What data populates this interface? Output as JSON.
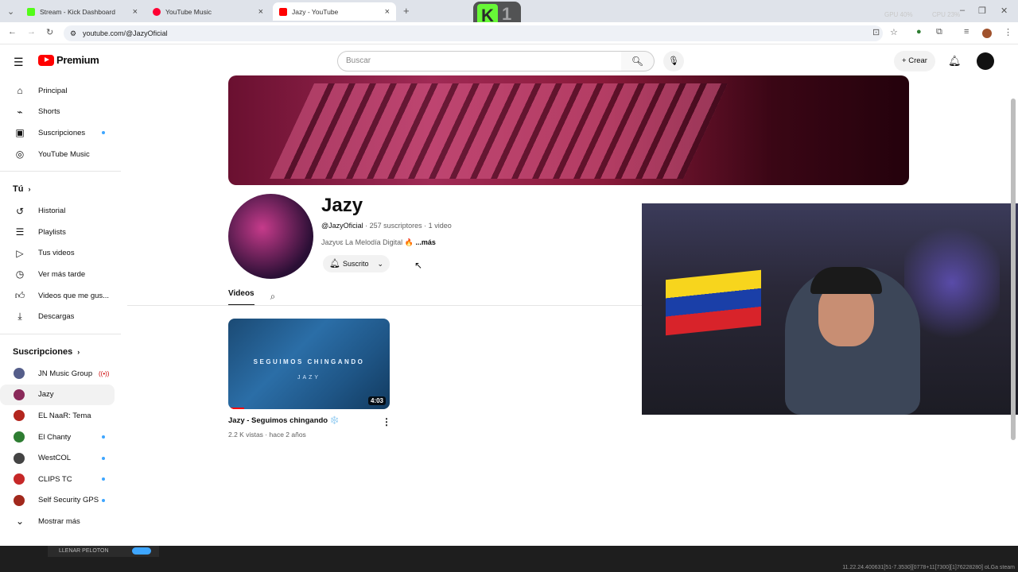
{
  "browser": {
    "tabs": [
      {
        "title": "Stream - Kick Dashboard",
        "icon": "kick-icon",
        "color": "#53fc18"
      },
      {
        "title": "YouTube Music",
        "icon": "youtube-music-icon",
        "color": "#ff0033"
      },
      {
        "title": "Jazy - YouTube",
        "icon": "youtube-icon",
        "color": "#ff0000"
      }
    ],
    "url": "youtube.com/@JazyOficial",
    "sys": {
      "gpu": "GPU 40%",
      "cpu": "CPU 23%"
    },
    "overlay_badge": {
      "letter": "K",
      "number": "1"
    }
  },
  "masthead": {
    "logo": "Premium",
    "search_placeholder": "Buscar",
    "create_label": "Crear"
  },
  "sidebar": {
    "main": [
      {
        "label": "Principal",
        "icon": "home-icon"
      },
      {
        "label": "Shorts",
        "icon": "shorts-icon"
      },
      {
        "label": "Suscripciones",
        "icon": "subscriptions-icon",
        "dot": true
      },
      {
        "label": "YouTube Music",
        "icon": "youtube-music-icon"
      }
    ],
    "you_heading": "Tú",
    "you": [
      {
        "label": "Historial",
        "icon": "history-icon"
      },
      {
        "label": "Playlists",
        "icon": "playlists-icon"
      },
      {
        "label": "Tus videos",
        "icon": "your-videos-icon"
      },
      {
        "label": "Ver más tarde",
        "icon": "watch-later-icon"
      },
      {
        "label": "Videos que me gus...",
        "icon": "liked-icon"
      },
      {
        "label": "Descargas",
        "icon": "downloads-icon"
      }
    ],
    "subs_heading": "Suscripciones",
    "subs": [
      {
        "label": "JN Music Group",
        "color": "#555e8a",
        "live": true
      },
      {
        "label": "Jazy",
        "color": "#8a2a5a",
        "selected": true
      },
      {
        "label": "EL NaaR: Tema",
        "color": "#b3261e"
      },
      {
        "label": "El Chanty",
        "color": "#2e7d32",
        "dot": true
      },
      {
        "label": "WestCOL",
        "color": "#444",
        "dot": true
      },
      {
        "label": "CLIPS TC",
        "color": "#c62828",
        "dot": true
      },
      {
        "label": "Self Security GPS",
        "color": "#a1281c",
        "dot": true
      }
    ],
    "show_more": "Mostrar más"
  },
  "channel": {
    "name": "Jazy",
    "handle": "@JazyOficial",
    "stats": " · 257 suscriptores · 1 video",
    "description": "Jazyʋɛ La Melodía Digital 🔥",
    "more": " ...más",
    "subscribed_label": "Suscrito",
    "tabs": [
      "Videos"
    ]
  },
  "videos": [
    {
      "title": "Jazy - Seguimos chingando ❄️",
      "meta": "2.2 K vistas · hace 2 años",
      "duration": "4:03",
      "thumb_line1": "SEGUIMOS CHINGANDO",
      "thumb_line2": "JAZY",
      "progress": 0.1
    }
  ],
  "taskbar": {
    "item": "LLENAR PELOTON",
    "corner": "11.22.24.400631[51-7.3530][0778+11[7300][1]76228280] oLGa steam"
  }
}
